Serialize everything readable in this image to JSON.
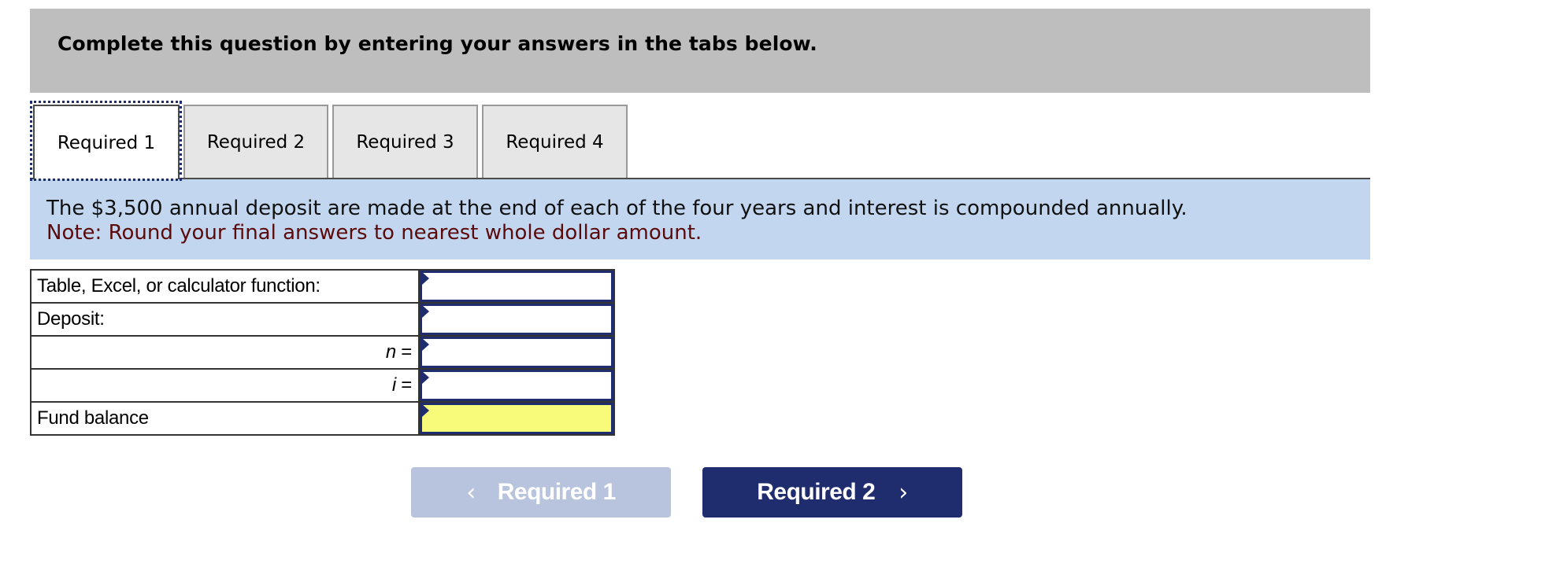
{
  "header": {
    "instruction": "Complete this question by entering your answers in the tabs below."
  },
  "tabs": [
    {
      "label": "Required 1",
      "active": true
    },
    {
      "label": "Required 2",
      "active": false
    },
    {
      "label": "Required 3",
      "active": false
    },
    {
      "label": "Required 4",
      "active": false
    }
  ],
  "instructions": {
    "text": "The $3,500 annual deposit are made at the end of each of the four years and interest is compounded annually.",
    "note": "Note: Round your final answers to nearest whole dollar amount."
  },
  "answer_table": {
    "rows": [
      {
        "label": "Table, Excel, or calculator function:",
        "value": "",
        "highlight": false
      },
      {
        "label": "Deposit:",
        "value": "",
        "highlight": false
      },
      {
        "var": "n",
        "eq": " =",
        "value": "",
        "highlight": false
      },
      {
        "var": "i",
        "eq": " =",
        "value": "",
        "highlight": false
      },
      {
        "label": "Fund balance",
        "value": "",
        "highlight": true
      }
    ]
  },
  "navigation": {
    "prev": {
      "label": "Required 1",
      "icon": "chevron-left-icon",
      "glyph": "‹",
      "enabled": false
    },
    "next": {
      "label": "Required 2",
      "icon": "chevron-right-icon",
      "glyph": "›",
      "enabled": true
    }
  },
  "colors": {
    "header_bg": "#bebebe",
    "instructions_bg": "#c3d6ef",
    "note_text": "#5a0a0a",
    "input_border": "#1f2d6e",
    "highlight_cell": "#f7fb79",
    "next_button": "#1f2d6e",
    "prev_button_disabled": "#b8c4dd"
  }
}
